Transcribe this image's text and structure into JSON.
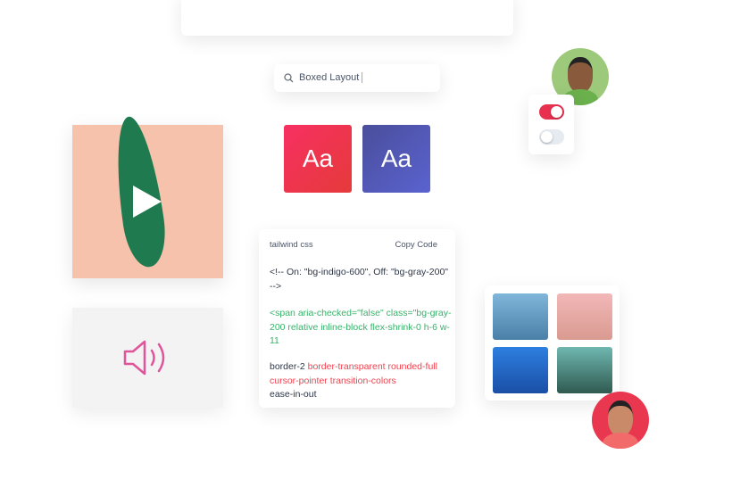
{
  "search": {
    "value": "Boxed Layout"
  },
  "toggles": [
    {
      "state": "on",
      "color": "#e8304f"
    },
    {
      "state": "off",
      "color": "#e5ebf0"
    }
  ],
  "type_samples": [
    {
      "label": "Aa"
    },
    {
      "label": "Aa"
    }
  ],
  "code_card": {
    "title": "tailwind css",
    "copy_label": "Copy Code",
    "comment": "<!-- On: \"bg-indigo-600\", Off: \"bg-gray-200\" -->",
    "green_line": "<span aria-checked=\"false\" class=\"bg-gray-200 relative inline-block flex-shrink-0 h-6 w-11",
    "plain1": "border-2 ",
    "red": "border-transparent rounded-full cursor-pointer transition-colors",
    "plain2": "ease-in-out"
  },
  "colors": {
    "green": "#38b26a",
    "red": "#f0434f",
    "accent": "#e8304f"
  }
}
